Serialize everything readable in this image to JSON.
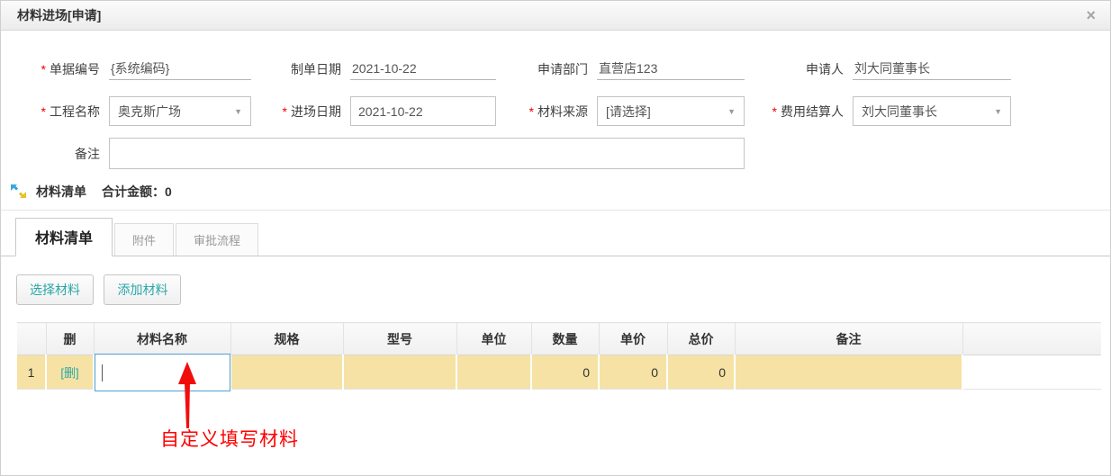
{
  "window": {
    "title": "材料进场[申请]",
    "close_icon": "×"
  },
  "form": {
    "required_mark": "*",
    "dropdown_icon": "▼",
    "doc_no": {
      "label": "单据编号",
      "value": "{系统编码}"
    },
    "doc_date": {
      "label": "制单日期",
      "value": "2021-10-22"
    },
    "dept": {
      "label": "申请部门",
      "value": "直营店123"
    },
    "applicant": {
      "label": "申请人",
      "value": "刘大同董事长"
    },
    "project": {
      "label": "工程名称",
      "value": "奥克斯广场"
    },
    "entry_date": {
      "label": "进场日期",
      "value": "2021-10-22"
    },
    "source": {
      "label": "材料来源",
      "value": "[请选择]"
    },
    "settler": {
      "label": "费用结算人",
      "value": "刘大同董事长"
    },
    "remark": {
      "label": "备注",
      "value": ""
    }
  },
  "section": {
    "title": "材料清单",
    "total_label": "合计金额：0"
  },
  "tabs": {
    "items": [
      {
        "label": "材料清单",
        "active": true
      },
      {
        "label": "附件",
        "active": false
      },
      {
        "label": "审批流程",
        "active": false
      }
    ]
  },
  "toolbar": {
    "select_material": "选择材料",
    "add_material": "添加材料"
  },
  "table": {
    "columns": [
      "",
      "删",
      "材料名称",
      "规格",
      "型号",
      "单位",
      "数量",
      "单价",
      "总价",
      "备注",
      ""
    ],
    "rows": [
      {
        "num": "1",
        "delete_link": "[删]",
        "material_name": "",
        "spec": "",
        "model": "",
        "unit": "",
        "qty": "0",
        "price": "0",
        "total": "0",
        "remark": ""
      }
    ]
  },
  "annotation": {
    "text": "自定义填写材料"
  },
  "colors": {
    "accent_teal": "#2aa7a7",
    "row_highlight": "#f6e2a4",
    "focus_blue": "#4f9fd8",
    "annotation_red": "#fd0100"
  }
}
